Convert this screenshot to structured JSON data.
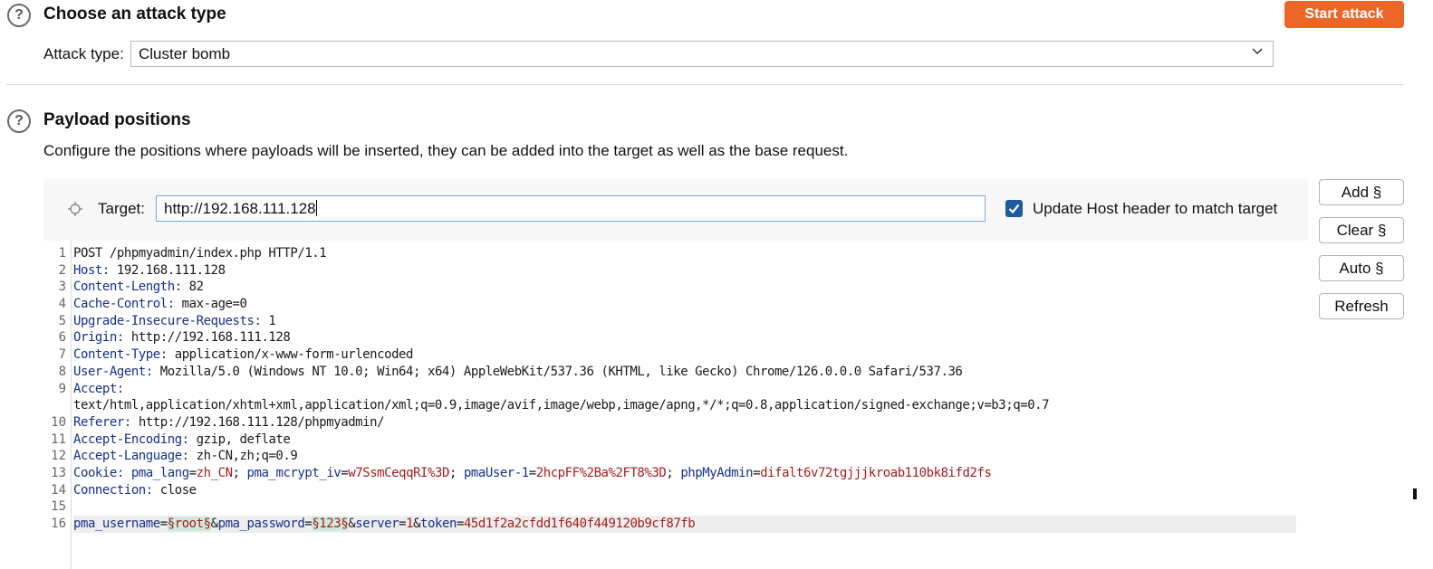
{
  "attack_section": {
    "title": "Choose an attack type",
    "start_button": "Start attack",
    "attack_type_label": "Attack type:",
    "attack_type_value": "Cluster bomb"
  },
  "payload_section": {
    "title": "Payload positions",
    "description": "Configure the positions where payloads will be inserted, they can be added into the target as well as the base request.",
    "target_label": "Target:",
    "target_value": "http://192.168.111.128",
    "update_host_label": "Update Host header to match target",
    "update_host_checked": true,
    "buttons": {
      "add": "Add §",
      "clear": "Clear §",
      "auto": "Auto §",
      "refresh": "Refresh"
    }
  },
  "request": {
    "line_numbers": [
      "1",
      "2",
      "3",
      "4",
      "5",
      "6",
      "7",
      "8",
      "9",
      "",
      "10",
      "11",
      "12",
      "13",
      "14",
      "15",
      "16"
    ],
    "l1": "POST /phpmyadmin/index.php HTTP/1.1",
    "l2k": "Host:",
    "l2v": " 192.168.111.128",
    "l3k": "Content-Length:",
    "l3v": " 82",
    "l4k": "Cache-Control:",
    "l4v": " max-age=0",
    "l5k": "Upgrade-Insecure-Requests:",
    "l5v": " 1",
    "l6k": "Origin:",
    "l6v": " http://192.168.111.128",
    "l7k": "Content-Type:",
    "l7v": " application/x-www-form-urlencoded",
    "l8k": "User-Agent:",
    "l8v": " Mozilla/5.0 (Windows NT 10.0; Win64; x64) AppleWebKit/537.36 (KHTML, like Gecko) Chrome/126.0.0.0 Safari/537.36",
    "l9k": "Accept:",
    "l9v": "text/html,application/xhtml+xml,application/xml;q=0.9,image/avif,image/webp,image/apng,*/*;q=0.8,application/signed-exchange;v=b3;q=0.7",
    "l10k": "Referer:",
    "l10v": " http://192.168.111.128/phpmyadmin/",
    "l11k": "Accept-Encoding:",
    "l11v": " gzip, deflate",
    "l12k": "Accept-Language:",
    "l12v": " zh-CN,zh;q=0.9",
    "l13k": "Cookie:",
    "c1k": "pma_lang",
    "c1v": "zh_CN",
    "c2k": "pma_mcrypt_iv",
    "c2v": "w7SsmCeqqRI%3D",
    "c3k": "pmaUser-1",
    "c3v": "2hcpFF%2Ba%2FT8%3D",
    "c4k": "phpMyAdmin",
    "c4v": "difalt6v72tgjjjkroab110bk8ifd2fs",
    "l14k": "Connection:",
    "l14v": " close",
    "b_user_k": "pma_username",
    "b_user_v": "§root§",
    "b_pass_k": "pma_password",
    "b_pass_v": "§123§",
    "b_server_k": "server",
    "b_server_v": "1",
    "b_token_k": "token",
    "b_token_v": "45d1f2a2cfdd1f640f449120b9cf87fb"
  }
}
